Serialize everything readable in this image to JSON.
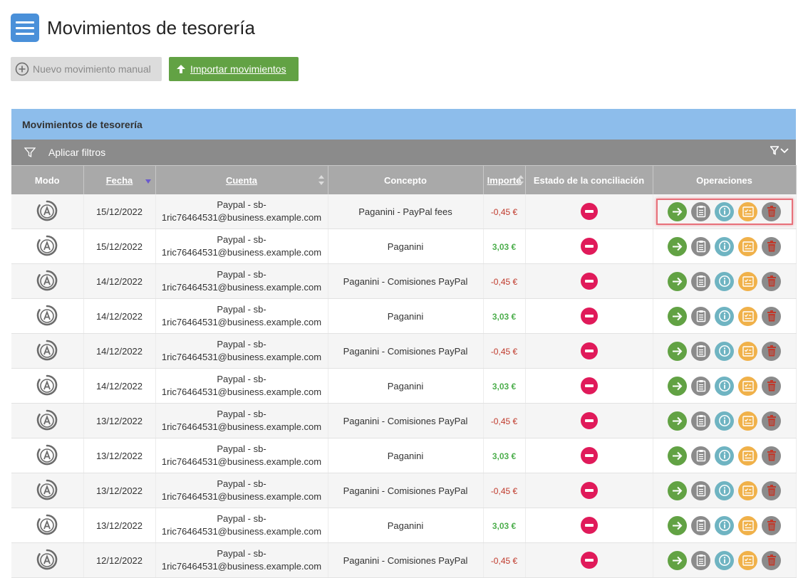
{
  "header": {
    "title": "Movimientos de tesorería"
  },
  "actions": {
    "manual_label": "Nuevo movimiento manual",
    "import_label": "Importar movimientos"
  },
  "panel": {
    "title": "Movimientos de tesorería",
    "filter_label": "Aplicar filtros"
  },
  "columns": {
    "modo": "Modo",
    "fecha": "Fecha",
    "cuenta": "Cuenta",
    "concepto": "Concepto",
    "importe": "Importe",
    "estado": "Estado de la conciliación",
    "operaciones": "Operaciones"
  },
  "colors": {
    "accent": "#4a90d9",
    "import": "#62a244",
    "negative": "#c0392b",
    "positive": "#4cae4c",
    "status": "#e01a5a"
  },
  "rows": [
    {
      "fecha": "15/12/2022",
      "cuenta_1": "Paypal - sb-",
      "cuenta_2": "1ric76464531@business.example.com",
      "concepto": "Paganini - PayPal fees",
      "importe": "-0,45 €",
      "sign": "neg"
    },
    {
      "fecha": "15/12/2022",
      "cuenta_1": "Paypal - sb-",
      "cuenta_2": "1ric76464531@business.example.com",
      "concepto": "Paganini",
      "importe": "3,03 €",
      "sign": "pos"
    },
    {
      "fecha": "14/12/2022",
      "cuenta_1": "Paypal - sb-",
      "cuenta_2": "1ric76464531@business.example.com",
      "concepto": "Paganini - Comisiones PayPal",
      "importe": "-0,45 €",
      "sign": "neg"
    },
    {
      "fecha": "14/12/2022",
      "cuenta_1": "Paypal - sb-",
      "cuenta_2": "1ric76464531@business.example.com",
      "concepto": "Paganini",
      "importe": "3,03 €",
      "sign": "pos"
    },
    {
      "fecha": "14/12/2022",
      "cuenta_1": "Paypal - sb-",
      "cuenta_2": "1ric76464531@business.example.com",
      "concepto": "Paganini - Comisiones PayPal",
      "importe": "-0,45 €",
      "sign": "neg"
    },
    {
      "fecha": "14/12/2022",
      "cuenta_1": "Paypal - sb-",
      "cuenta_2": "1ric76464531@business.example.com",
      "concepto": "Paganini",
      "importe": "3,03 €",
      "sign": "pos"
    },
    {
      "fecha": "13/12/2022",
      "cuenta_1": "Paypal - sb-",
      "cuenta_2": "1ric76464531@business.example.com",
      "concepto": "Paganini - Comisiones PayPal",
      "importe": "-0,45 €",
      "sign": "neg"
    },
    {
      "fecha": "13/12/2022",
      "cuenta_1": "Paypal - sb-",
      "cuenta_2": "1ric76464531@business.example.com",
      "concepto": "Paganini",
      "importe": "3,03 €",
      "sign": "pos"
    },
    {
      "fecha": "13/12/2022",
      "cuenta_1": "Paypal - sb-",
      "cuenta_2": "1ric76464531@business.example.com",
      "concepto": "Paganini - Comisiones PayPal",
      "importe": "-0,45 €",
      "sign": "neg"
    },
    {
      "fecha": "13/12/2022",
      "cuenta_1": "Paypal - sb-",
      "cuenta_2": "1ric76464531@business.example.com",
      "concepto": "Paganini",
      "importe": "3,03 €",
      "sign": "pos"
    },
    {
      "fecha": "12/12/2022",
      "cuenta_1": "Paypal - sb-",
      "cuenta_2": "1ric76464531@business.example.com",
      "concepto": "Paganini - Comisiones PayPal",
      "importe": "-0,45 €",
      "sign": "neg"
    }
  ]
}
